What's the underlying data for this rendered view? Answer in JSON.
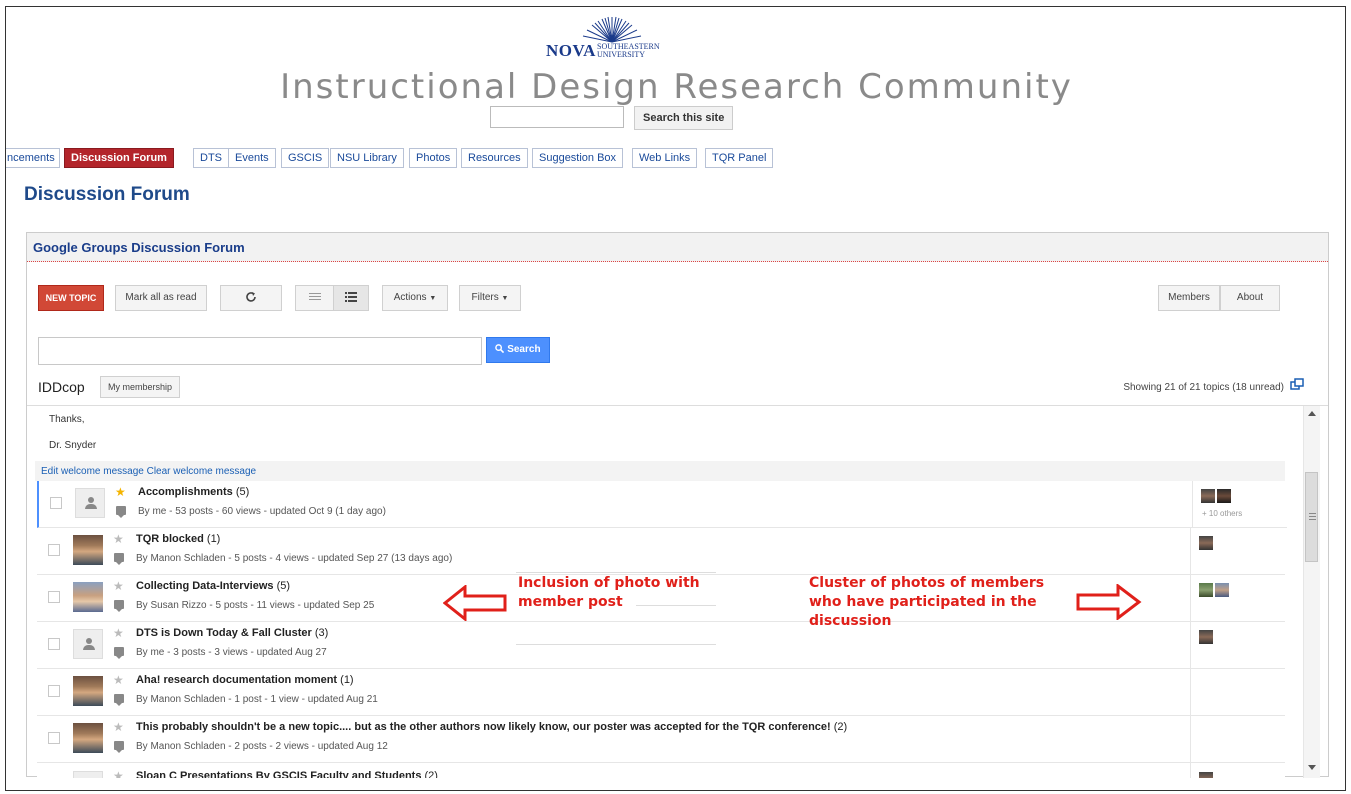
{
  "logo": {
    "brand": "NOVA",
    "sub_line1": "SOUTHEASTERN",
    "sub_line2": "UNIVERSITY"
  },
  "site": {
    "title": "Instructional Design Research Community",
    "search_button": "Search this site"
  },
  "nav_tabs": [
    {
      "label": "Announcements",
      "visible_label": "ncements"
    },
    {
      "label": "Discussion Forum",
      "active": true
    },
    {
      "label": "DTS"
    },
    {
      "label": "Events"
    },
    {
      "label": "GSCIS"
    },
    {
      "label": "NSU Library"
    },
    {
      "label": "Photos"
    },
    {
      "label": "Resources"
    },
    {
      "label": "Suggestion Box"
    },
    {
      "label": "Web Links"
    },
    {
      "label": "TQR Panel"
    }
  ],
  "page_heading": "Discussion Forum",
  "panel": {
    "title": "Google Groups Discussion Forum",
    "toolbar": {
      "new_topic": "NEW TOPIC",
      "mark_all_read": "Mark all as read",
      "refresh_icon": "refresh-icon",
      "actions": "Actions",
      "filters": "Filters",
      "members": "Members",
      "about": "About"
    },
    "search_button": "Search",
    "group_name": "IDDcop",
    "my_membership": "My membership",
    "showing": "Showing 21 of 21 topics (18 unread)",
    "welcome_lines": [
      "Thanks,",
      "Dr. Snyder"
    ],
    "edit_welcome": "Edit welcome message",
    "clear_welcome": "Clear welcome message",
    "topics": [
      {
        "title": "Accomplishments",
        "count": "(5)",
        "meta": "By me - 53 posts - 60 views - updated Oct 9 (1 day ago)",
        "starred": true,
        "avatar": "default",
        "extra": "+ 10 others"
      },
      {
        "title": "TQR blocked",
        "count": "(1)",
        "meta": "By Manon Schladen - 5 posts - 4 views - updated Sep 27 (13 days ago)",
        "starred": false,
        "avatar": "photo"
      },
      {
        "title": "Collecting Data-Interviews",
        "count": "(5)",
        "meta": "By Susan Rizzo - 5 posts - 11 views - updated Sep 25",
        "starred": false,
        "avatar": "photo2"
      },
      {
        "title": "DTS is Down Today & Fall Cluster",
        "count": "(3)",
        "meta": "By me - 3 posts - 3 views - updated Aug 27",
        "starred": false,
        "avatar": "default"
      },
      {
        "title": "Aha! research documentation moment",
        "count": "(1)",
        "meta": "By Manon Schladen - 1 post - 1 view - updated Aug 21",
        "starred": false,
        "avatar": "photo"
      },
      {
        "title": "This probably shouldn't be a new topic.... but as the other authors now likely know, our poster was accepted for the TQR conference!",
        "count": "(2)",
        "meta": "By Manon Schladen - 2 posts - 2 views - updated Aug 12",
        "starred": false,
        "avatar": "photo"
      },
      {
        "title": "Sloan C Presentations By GSCIS Faculty and Students",
        "count": "(2)",
        "meta": "",
        "starred": false,
        "avatar": "default"
      }
    ]
  },
  "annotations": {
    "left_line1": "Inclusion of photo with",
    "left_line2": "member post",
    "right_line1": "Cluster of photos of members",
    "right_line2": "who have participated in the",
    "right_line3": "discussion",
    "color": "#e0201a"
  },
  "colors": {
    "accent_red": "#b3252b",
    "heading_blue": "#1f4a8a",
    "google_red": "#d14836",
    "google_blue": "#4d90fe"
  }
}
